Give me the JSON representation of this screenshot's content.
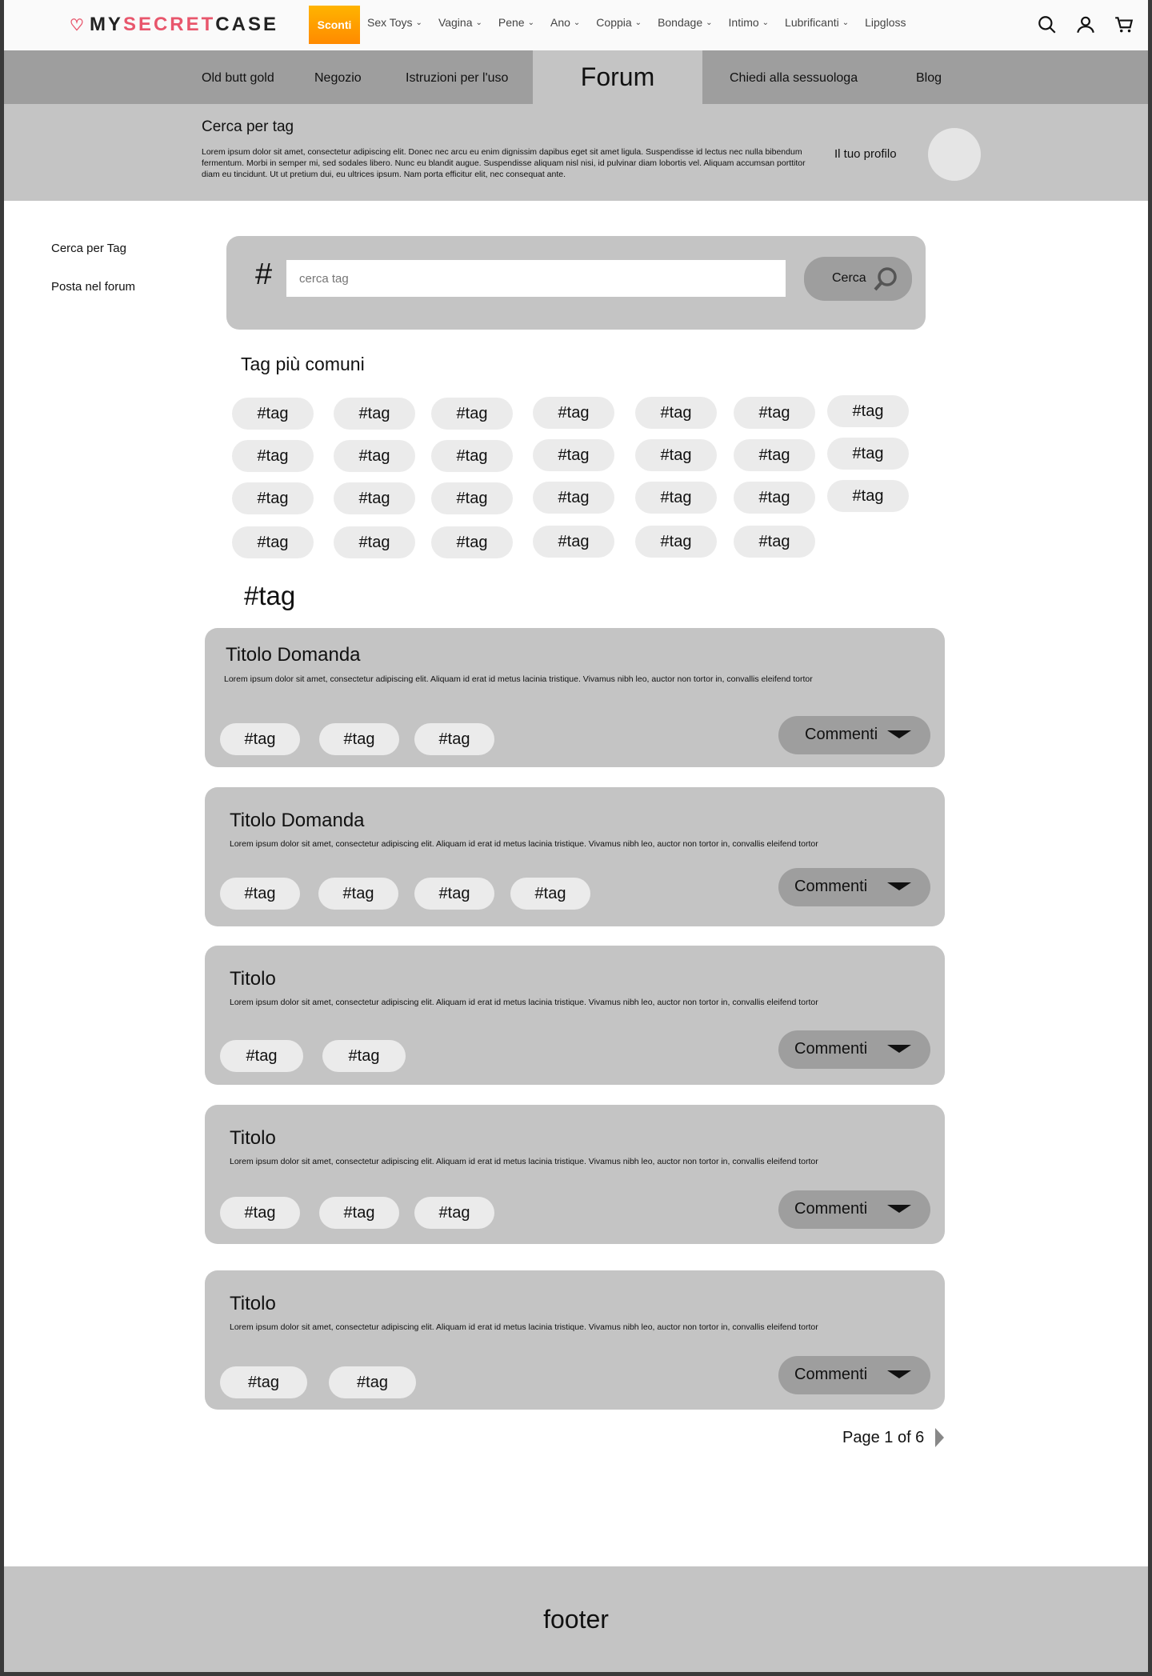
{
  "brand": {
    "prefix": "MY",
    "middle": "SECRET",
    "suffix": "CASE"
  },
  "topbar": {
    "promo": "Sconti",
    "menu": [
      {
        "label": "Sex Toys",
        "chevron": true
      },
      {
        "label": "Vagina",
        "chevron": true
      },
      {
        "label": "Pene",
        "chevron": true
      },
      {
        "label": "Ano",
        "chevron": true
      },
      {
        "label": "Coppia",
        "chevron": true
      },
      {
        "label": "Bondage",
        "chevron": true
      },
      {
        "label": "Intimo",
        "chevron": true
      },
      {
        "label": "Lubrificanti",
        "chevron": true
      },
      {
        "label": "Lipgloss",
        "chevron": false
      }
    ],
    "icons": [
      "search-icon",
      "account-icon",
      "cart-icon"
    ]
  },
  "forum_nav": {
    "items": [
      "Old butt gold",
      "Negozio",
      "Istruzioni per l'uso",
      "Chiedi alla sessuologa",
      "Blog"
    ],
    "active": "Forum"
  },
  "banner": {
    "title": "Cerca per tag",
    "text": "Lorem ipsum dolor sit amet, consectetur adipiscing elit. Donec nec arcu eu enim dignissim dapibus eget sit amet ligula. Suspendisse id lectus nec nulla bibendum fermentum. Morbi in semper mi, sed sodales libero. Nunc eu blandit augue. Suspendisse aliquam nisl nisi, id pulvinar diam lobortis vel. Aliquam accumsan porttitor diam eu tincidunt. Ut ut pretium dui, eu ultrices ipsum. Nam porta efficitur elit, nec consequat ante.",
    "profile_label": "Il tuo profilo"
  },
  "sidebar": {
    "items": [
      "Cerca per Tag",
      "Posta nel forum"
    ]
  },
  "search": {
    "hash": "#",
    "placeholder": "cerca tag",
    "button": "Cerca"
  },
  "common_tags": {
    "title": "Tag più comuni",
    "rows": [
      [
        "#tag",
        "#tag",
        "#tag",
        "#tag",
        "#tag",
        "#tag",
        "#tag"
      ],
      [
        "#tag",
        "#tag",
        "#tag",
        "#tag",
        "#tag",
        "#tag",
        "#tag"
      ],
      [
        "#tag",
        "#tag",
        "#tag",
        "#tag",
        "#tag",
        "#tag",
        "#tag"
      ],
      [
        "#tag",
        "#tag",
        "#tag",
        "#tag",
        "#tag",
        "#tag"
      ]
    ]
  },
  "current_tag": "#tag",
  "questions": [
    {
      "title": "Titolo Domanda",
      "text": "Lorem ipsum dolor sit amet, consectetur adipiscing elit. Aliquam id erat id metus lacinia tristique. Vivamus nibh leo, auctor non tortor in, convallis eleifend tortor",
      "tags": [
        "#tag",
        "#tag",
        "#tag"
      ],
      "comments": "Commenti"
    },
    {
      "title": "Titolo Domanda",
      "text": "Lorem ipsum dolor sit amet, consectetur adipiscing elit. Aliquam id erat id metus lacinia tristique. Vivamus nibh leo, auctor non tortor in, convallis eleifend tortor",
      "tags": [
        "#tag",
        "#tag",
        "#tag",
        "#tag"
      ],
      "comments": "Commenti"
    },
    {
      "title": "Titolo",
      "text": "Lorem ipsum dolor sit amet, consectetur adipiscing elit. Aliquam id erat id metus lacinia tristique. Vivamus nibh leo, auctor non tortor in, convallis eleifend tortor",
      "tags": [
        "#tag",
        "#tag"
      ],
      "comments": "Commenti"
    },
    {
      "title": "Titolo",
      "text": "Lorem ipsum dolor sit amet, consectetur adipiscing elit. Aliquam id erat id metus lacinia tristique. Vivamus nibh leo, auctor non tortor in, convallis eleifend tortor",
      "tags": [
        "#tag",
        "#tag",
        "#tag"
      ],
      "comments": "Commenti"
    },
    {
      "title": "Titolo",
      "text": "Lorem ipsum dolor sit amet, consectetur adipiscing elit. Aliquam id erat id metus lacinia tristique. Vivamus nibh leo, auctor non tortor in, convallis eleifend tortor",
      "tags": [
        "#tag",
        "#tag"
      ],
      "comments": "Commenti"
    }
  ],
  "pagination": {
    "label": "Page 1 of 6"
  },
  "footer": {
    "label": "footer"
  },
  "colors": {
    "accent": "#e8566c",
    "promo": "#ff9800",
    "panel": "#c4c4c4",
    "dark_panel": "#9e9e9e",
    "chip": "#ebebeb"
  }
}
